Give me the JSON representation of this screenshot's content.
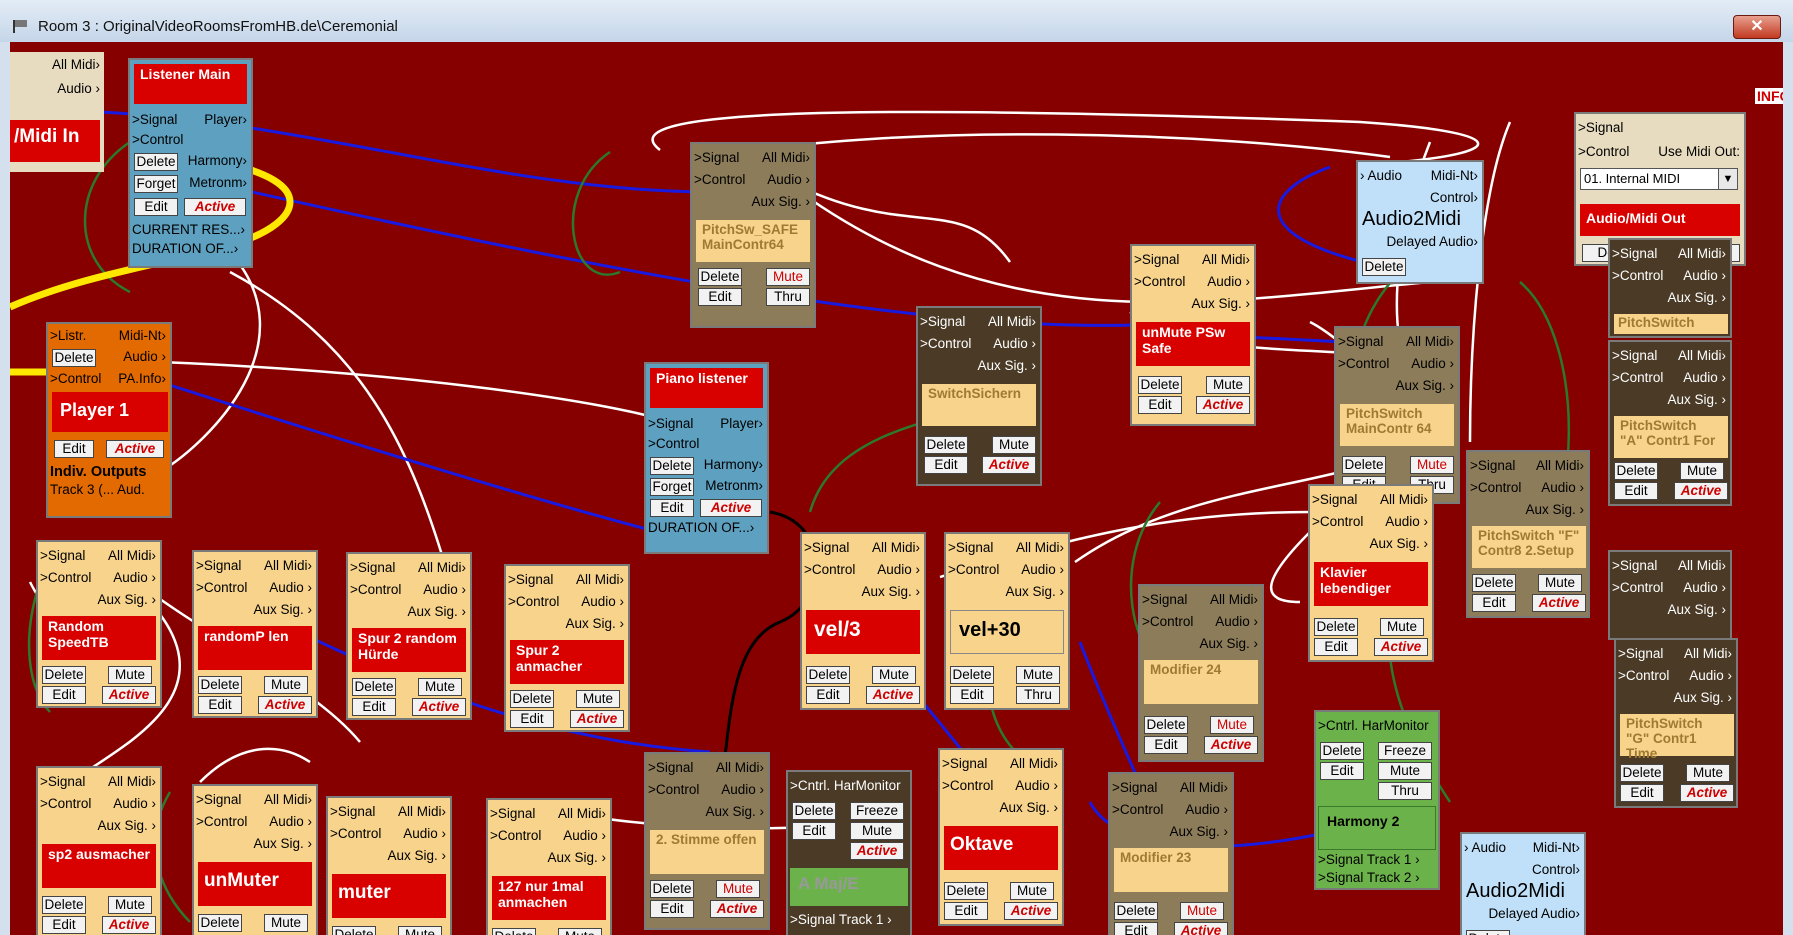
{
  "window": {
    "title": "Room 3 : OriginalVideoRoomsFromHB.de\\Ceremonial",
    "close_glyph": "✕",
    "info": "INFO"
  },
  "common": {
    "signal": ">Signal",
    "all_midi": "All Midi›",
    "control": ">Control",
    "audio": "Audio ›",
    "aux": "Aux Sig. ›",
    "delete": "Delete",
    "edit": "Edit",
    "mute": "Mute",
    "active": "Active",
    "thru": "Thru",
    "freeze": "Freeze"
  },
  "midi_in": {
    "all_midi": "All Midi›",
    "audio": "Audio ›",
    "label": "/Midi In"
  },
  "listener_main": {
    "title": "Listener Main",
    "signal": ">Signal",
    "player": "Player›",
    "control": ">Control",
    "harmony": "Harmony›",
    "forget": "Forget",
    "metronom": "Metronm›",
    "current": "CURRENT RES...›",
    "duration": "DURATION OF...›"
  },
  "player1": {
    "listr": ">Listr.",
    "midi_nt": "Midi-Nt›",
    "audio": "Audio ›",
    "control": ">Control",
    "painfo": "PA.Info›",
    "title": "Player 1",
    "indiv": "Indiv. Outputs",
    "track": "Track 3 (... Aud."
  },
  "piano_listener": {
    "title": "Piano listener",
    "signal": ">Signal",
    "player": "Player›",
    "control": ">Control",
    "harmony": "Harmony›",
    "forget": "Forget",
    "metronom": "Metronm›",
    "duration": "DURATION OF...›"
  },
  "pitchsw_safe": {
    "label": "PitchSw_SAFE MainContr64"
  },
  "switchsichern": {
    "label": "SwitchSichern"
  },
  "unmute_psw": {
    "label": "unMute PSw Safe"
  },
  "pitchswitch_main": {
    "label": "PitchSwitch MainContr 64"
  },
  "audio2midi_1": {
    "audio": "› Audio",
    "midi_nt": "Midi-Nt›",
    "control": "Control›",
    "title": "Audio2Midi",
    "delayed": "Delayed Audio›"
  },
  "audio_midi_out": {
    "signal": ">Signal",
    "control": ">Control",
    "use_midi": "Use Midi Out:",
    "select": "01. Internal MIDI",
    "label": "Audio/Midi Out"
  },
  "right_stack": {
    "p1": "PitchSwitch",
    "p2": "PitchSwitch \"A\" Contr1 For",
    "p3": "PitchSwitch \"F\" Contr8 2.Setup",
    "p4": "PitchSwitch \"G\" Contr1 Time"
  },
  "row1": {
    "random": "Random SpeedTB",
    "randomp": "randomP len",
    "spur2": "Spur 2 random Hürde",
    "anmacher": "Spur 2 anmacher",
    "vel3": "vel/3",
    "vel30": "vel+30",
    "klavier": "Klavier lebendiger",
    "mod24": "Modifier 24"
  },
  "row2": {
    "sp2": "sp2 ausmacher",
    "unmuter": "unMuter",
    "muter": "muter",
    "n127": "127 nur 1mal anmachen",
    "stimme": "2. Stimme offen",
    "oktave": "Oktave",
    "mod23": "Modifier 23"
  },
  "harmonitor1": {
    "title": ">Cntrl. HarMonitor",
    "chord": "A Maj/E",
    "track1": ">Signal Track 1 ›"
  },
  "harmonitor2": {
    "title": ">Cntrl. HarMonitor",
    "label": "Harmony 2",
    "track1": ">Signal Track 1 ›",
    "track2": ">Signal Track 2 ›"
  },
  "audio2midi_2": {
    "audio": "› Audio",
    "midi_nt": "Midi-Nt›",
    "control": "Control›",
    "title": "Audio2Midi",
    "delayed": "Delayed Audio›"
  }
}
